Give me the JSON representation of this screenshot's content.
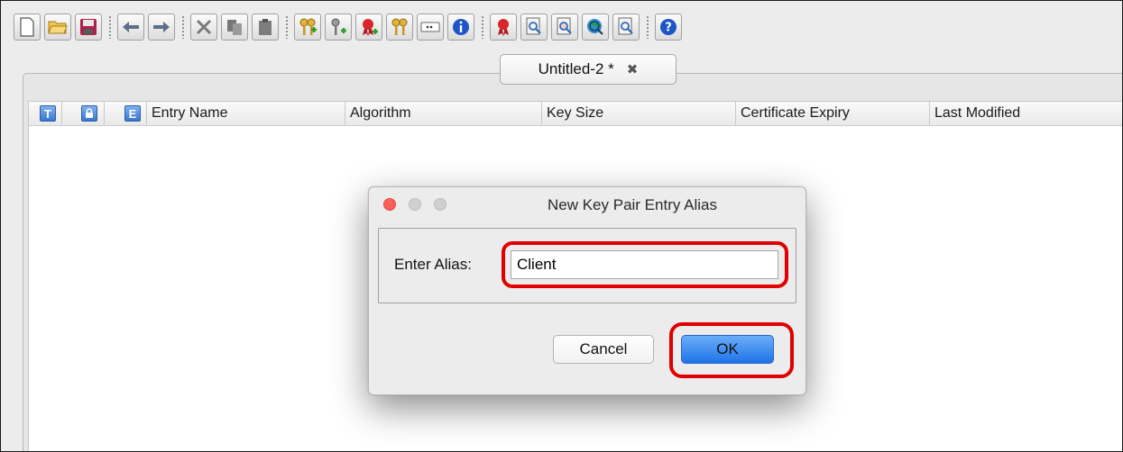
{
  "tab": {
    "title": "Untitled-2 *",
    "close_glyph": "✖"
  },
  "toolbar": {
    "icons": [
      "new-file-icon",
      "open-folder-icon",
      "save-icon",
      "undo-icon",
      "redo-icon",
      "cut-icon",
      "copy-icon",
      "paste-icon",
      "generate-key-pair-icon",
      "generate-secret-key-icon",
      "import-trusted-cert-icon",
      "import-key-pair-icon",
      "set-password-icon",
      "properties-info-icon",
      "examine-certificate-icon",
      "examine-crl-icon",
      "examine-csr-icon",
      "examine-ssl-icon",
      "examine-file-icon",
      "help-icon"
    ]
  },
  "table": {
    "icon_columns": [
      "T",
      "🔒",
      "E"
    ],
    "columns": [
      "Entry Name",
      "Algorithm",
      "Key Size",
      "Certificate Expiry",
      "Last Modified"
    ]
  },
  "dialog": {
    "title": "New Key Pair Entry Alias",
    "alias_label": "Enter Alias:",
    "alias_value": "Client",
    "cancel_label": "Cancel",
    "ok_label": "OK"
  },
  "colors": {
    "highlight": "#e00000",
    "ok_button": "#1f73e8",
    "traffic_close": "#fc5f57",
    "traffic_inactive": "#cfcfcf"
  }
}
